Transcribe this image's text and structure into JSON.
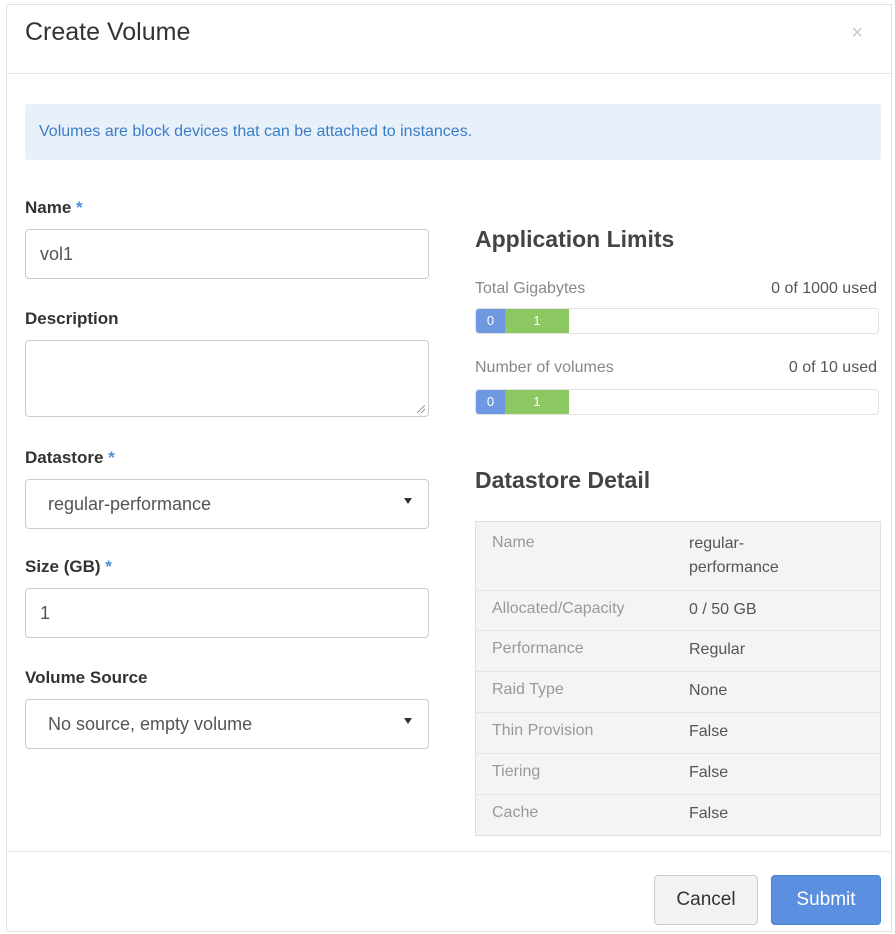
{
  "modal": {
    "title": "Create Volume",
    "close_glyph": "×",
    "info_text": "Volumes are block devices that can be attached to instances."
  },
  "form": {
    "name_label": "Name",
    "name_value": "vol1",
    "description_label": "Description",
    "description_value": "",
    "datastore_label": "Datastore",
    "datastore_value": "regular-performance",
    "size_label": "Size (GB)",
    "size_value": "1",
    "volume_source_label": "Volume Source",
    "volume_source_value": "No source, empty volume",
    "required_marker": "*"
  },
  "limits": {
    "title": "Application Limits",
    "items": [
      {
        "label": "Total Gigabytes",
        "used_text": "0 of 1000 used",
        "current": "0",
        "added": "1"
      },
      {
        "label": "Number of volumes",
        "used_text": "0 of 10 used",
        "current": "0",
        "added": "1"
      }
    ]
  },
  "datastore_detail": {
    "title": "Datastore Detail",
    "rows": [
      {
        "key": "Name",
        "value": "regular-\nperformance"
      },
      {
        "key": "Allocated/Capacity",
        "value": "0 / 50 GB"
      },
      {
        "key": "Performance",
        "value": "Regular"
      },
      {
        "key": "Raid Type",
        "value": "None"
      },
      {
        "key": "Thin Provision",
        "value": "False"
      },
      {
        "key": "Tiering",
        "value": "False"
      },
      {
        "key": "Cache",
        "value": "False"
      }
    ]
  },
  "footer": {
    "cancel_label": "Cancel",
    "submit_label": "Submit"
  },
  "colors": {
    "accent": "#5b8fe0",
    "info_bg": "#e8f0fa",
    "bar_current": "#6e98e0",
    "bar_added": "#8cc761"
  }
}
